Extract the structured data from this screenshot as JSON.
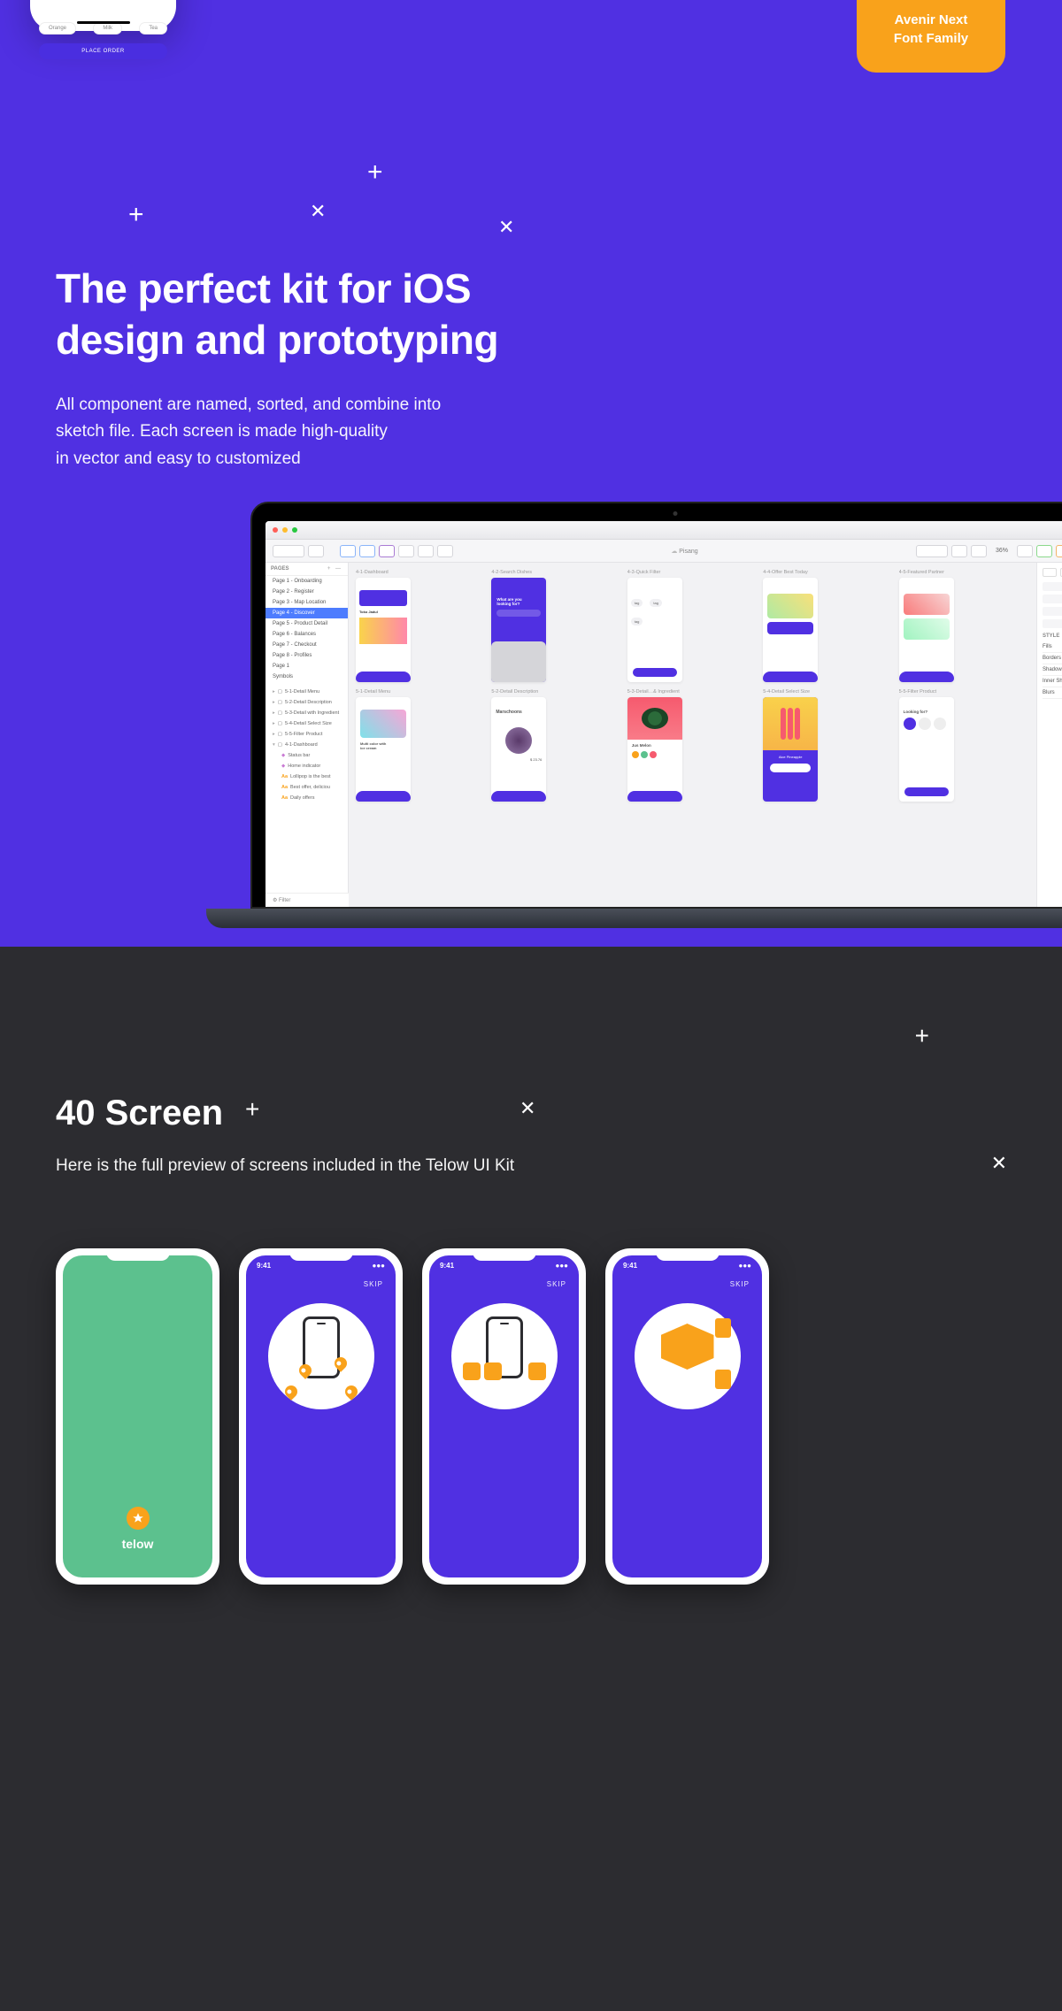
{
  "hero": {
    "font_badge": "Avenir Next\nFont Family",
    "phone": {
      "tag1": "Orange",
      "tag2": "Milk",
      "tag3": "Tea",
      "cta": "PLACE ORDER"
    },
    "headline_l1": "The perfect kit for iOS",
    "headline_l2": "design and prototyping",
    "sub_l1": "All component are named, sorted, and combine into",
    "sub_l2": "sketch file. Each screen is made high-quality",
    "sub_l3": "in vector and easy to customized"
  },
  "sketch": {
    "doc_title": "Pisang",
    "zoom": "36%",
    "pages_header": "PAGES",
    "pages": [
      "Page 1 - Onboarding",
      "Page 2 - Register",
      "Page 3 - Map Location",
      "Page 4 - Discover",
      "Page 5 - Product Detail",
      "Page 6 - Balances",
      "Page 7 - Checkout",
      "Page 8 - Profiles",
      "Page 1",
      "Symbols"
    ],
    "selected_page_index": 3,
    "layers": [
      "5-1-Detail Menu",
      "5-2-Detail Description",
      "5-3-Detail with Ingredient",
      "5-4-Detail Select Size",
      "5-5-Filter Product",
      "4-1-Dashboard"
    ],
    "layer_children": [
      {
        "icon": "sym",
        "label": "Status bar"
      },
      {
        "icon": "sym",
        "label": "Home indicator"
      },
      {
        "icon": "aa",
        "label": "Lollipop is the best"
      },
      {
        "icon": "aa",
        "label": "Best offer, deliciou"
      },
      {
        "icon": "aa",
        "label": "Daily offers"
      }
    ],
    "filter": "Filter",
    "artboards_row1": [
      "4-1-Dashboard",
      "4-2-Search Dishes",
      "4-3-Quick Filter",
      "4-4-Offer Best Today",
      "4-5-Featured Partner"
    ],
    "artboards_row2": [
      "5-1-Detail Menu",
      "5-2-Detail Description",
      "5-3-Detail…& Ingredient",
      "5-4-Detail Select Size",
      "5-5-Filter Product"
    ],
    "inspector": {
      "style": "STYLE",
      "props": [
        "Fills",
        "Borders",
        "Shadows",
        "Inner Shadows",
        "Blurs"
      ]
    }
  },
  "dark": {
    "title": "40 Screen",
    "subtitle": "Here is the full preview of screens included in the Telow UI Kit",
    "phone1": {
      "brand": "telow"
    },
    "onboard": {
      "time": "9:41",
      "skip": "SKIP"
    }
  }
}
